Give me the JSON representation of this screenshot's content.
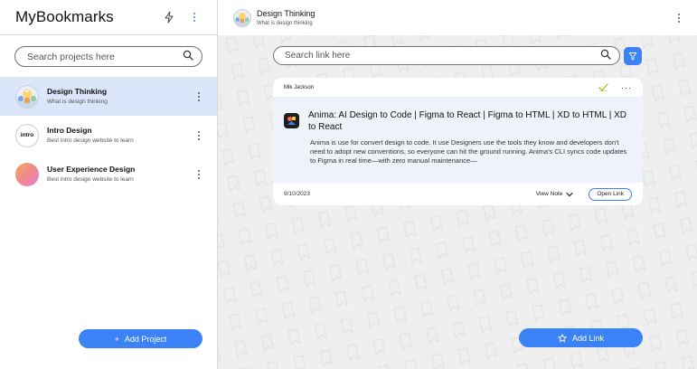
{
  "sidebar": {
    "title": "MyBookmarks",
    "header_icons": [
      "lightning-icon",
      "kebab-icon"
    ],
    "search_placeholder": "Search projects here",
    "projects": [
      {
        "name": "Design Thinking",
        "description": "What is design thinking",
        "avatar": "design-thinking-illustration",
        "active": true
      },
      {
        "name": "Intro Design",
        "description": "Best intro design website to learn",
        "avatar_text": "intro",
        "active": false
      },
      {
        "name": "User Experience Design",
        "description": "Best intro design website to learn",
        "avatar": "gradient-circle",
        "active": false
      }
    ],
    "add_project_label": "Add Project"
  },
  "main": {
    "header": {
      "title": "Design Thinking",
      "subtitle": "What is design thinking"
    },
    "search_placeholder": "Search link here",
    "links": [
      {
        "author": "Mik Jackson",
        "title": "Anima: AI Design to Code | Figma to React | Figma to HTML | XD to HTML | XD to React",
        "description": "Anima is use for convert design to code. It use Designers use the tools they know and developers don't need to adopt new conventions, so everyone can hit the ground running. Anima's CLI syncs code updates to Figma in real time—with zero manual maintenance—",
        "date": "9/10/2023",
        "view_note_label": "View Note",
        "open_link_label": "Open Link"
      }
    ],
    "add_link_label": "Add Link"
  },
  "colors": {
    "accent": "#3b82f6",
    "active_row": "#dbe6fb",
    "card_body": "#eef2fb",
    "canvas": "#efefef",
    "check": "#a6c41a"
  }
}
